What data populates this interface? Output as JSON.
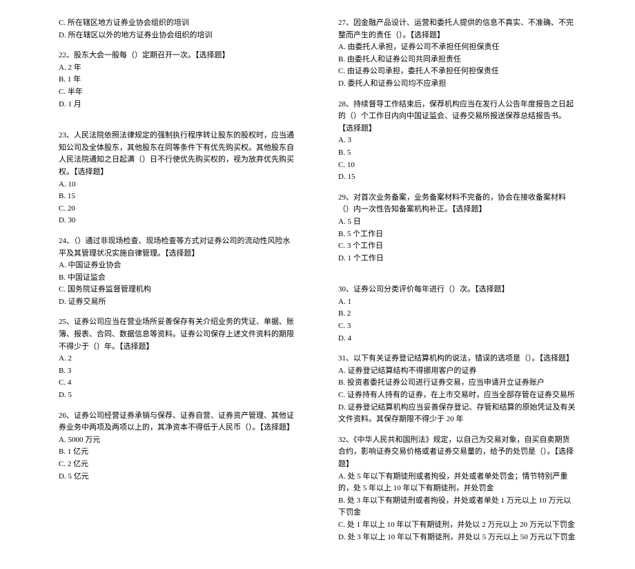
{
  "left": {
    "q21_c": "C. 所在辖区地方证券业协会组织的培训",
    "q21_d": "D. 所在辖区以外的地方证券业协会组织的培训",
    "q22_stem": "22、股东大会一般每（）定期召开一次。【选择题】",
    "q22_a": "A. 2 年",
    "q22_b": "B. 1 年",
    "q22_c": "C. 半年",
    "q22_d": "D. 1 月",
    "q23_stem": "23、人民法院依照法律规定的强制执行程序转让股东的股权时，应当通知公司及全体股东，其他股东在同等条件下有优先购买权。其他股东自人民法院通知之日起满（）日不行使优先购买权的，视为放弃优先购买权。【选择题】",
    "q23_a": "A. 10",
    "q23_b": "B. 15",
    "q23_c": "C. 20",
    "q23_d": "D. 30",
    "q24_stem": "24、（）通过非现场检查、现场检查等方式对证券公司的流动性风险水平及其管理状况实施自律管理。【选择题】",
    "q24_a": "A. 中国证券业协会",
    "q24_b": "B. 中国证监会",
    "q24_c": "C. 国务院证券监督管理机构",
    "q24_d": "D. 证券交易所",
    "q25_stem": "25、证券公司应当在营业场所妥善保存有关介绍业务的凭证、单据、账簿、报表、合同、数据信息等资料。证券公司保存上述文件资料的期限不得少于（）年。【选择题】",
    "q25_a": "A. 2",
    "q25_b": "B. 3",
    "q25_c": "C. 4",
    "q25_d": "D. 5",
    "q26_stem": "26、证券公司经营证券承销与保荐、证券自营、证券资产管理、其他证券业务中两项及两项以上的，其净资本不得低于人民币（）。【选择题】",
    "q26_a": "A. 5000 万元",
    "q26_b": "B. 1 亿元",
    "q26_c": "C. 2 亿元",
    "q26_d": "D. 5 亿元"
  },
  "right": {
    "q27_stem": "27、因金融产品设计、运营和委托人提供的信息不真实、不准确、不完整而产生的责任（）。【选择题】",
    "q27_a": "A. 由委托人承担，证券公司不承担任何担保责任",
    "q27_b": "B. 由委托人和证券公司共同承担责任",
    "q27_c": "C. 由证券公司承担，委托人不承担任何担保责任",
    "q27_d": "D. 委托人和证券公司均不应承担",
    "q28_stem": "28、持续督导工作结束后，保荐机构应当在发行人公告年度报告之日起的（）个工作日内向中国证监会、证券交易所报送保荐总结报告书。【选择题】",
    "q28_a": "A. 3",
    "q28_b": "B. 5",
    "q28_c": "C. 10",
    "q28_d": "D. 15",
    "q29_stem": "29、对首次业务备案，业务备案材料不完备的，协会在接收备案材料（）内一次性告知备案机构补正。【选择题】",
    "q29_a": "A. 5 日",
    "q29_b": "B. 5 个工作日",
    "q29_c": "C. 3 个工作日",
    "q29_d": "D. 1 个工作日",
    "q30_stem": "30、证券公司分类评价每年进行（）次。【选择题】",
    "q30_a": "A. 1",
    "q30_b": "B. 2",
    "q30_c": "C. 3",
    "q30_d": "D. 4",
    "q31_stem": "31、以下有关证券登记结算机构的说法，错误的选项是（）。【选择题】",
    "q31_a": "A. 证券登记结算结构不得挪用客户的证券",
    "q31_b": "B. 投资者委托证券公司进行证券交易，应当申请开立证券账户",
    "q31_c": "C. 证券持有人持有的证券，在上市交易时，应当全部存管在证券交易所",
    "q31_d": "D. 证券登记结算机构应当妥善保存登记、存管和结算的原始凭证及有关文件资料。其保存期限不得少于 20 年",
    "q32_stem": "32、《中华人民共和国刑法》规定，以自己为交易对象，自买自卖期货合约，影响证券交易价格或者证券交易量的，给予的处罚是（）。【选择题】",
    "q32_a": "A. 处 5 年以下有期徒刑或者拘役，并处或者单处罚金；情节特别严重的，处 5 年以上 10 年以下有期徒刑，并处罚金",
    "q32_b": "B. 处 3 年以下有期徒刑或者拘役，并处或者单处 1 万元以上 10 万元以下罚金",
    "q32_c": "C. 处 1 年以上 10 年以下有期徒刑，并处以 2 万元以上 20 万元以下罚金",
    "q32_d": "D. 处 3 年以上 10 年以下有期徒刑，并处以 5 万元以上 50 万元以下罚金"
  }
}
